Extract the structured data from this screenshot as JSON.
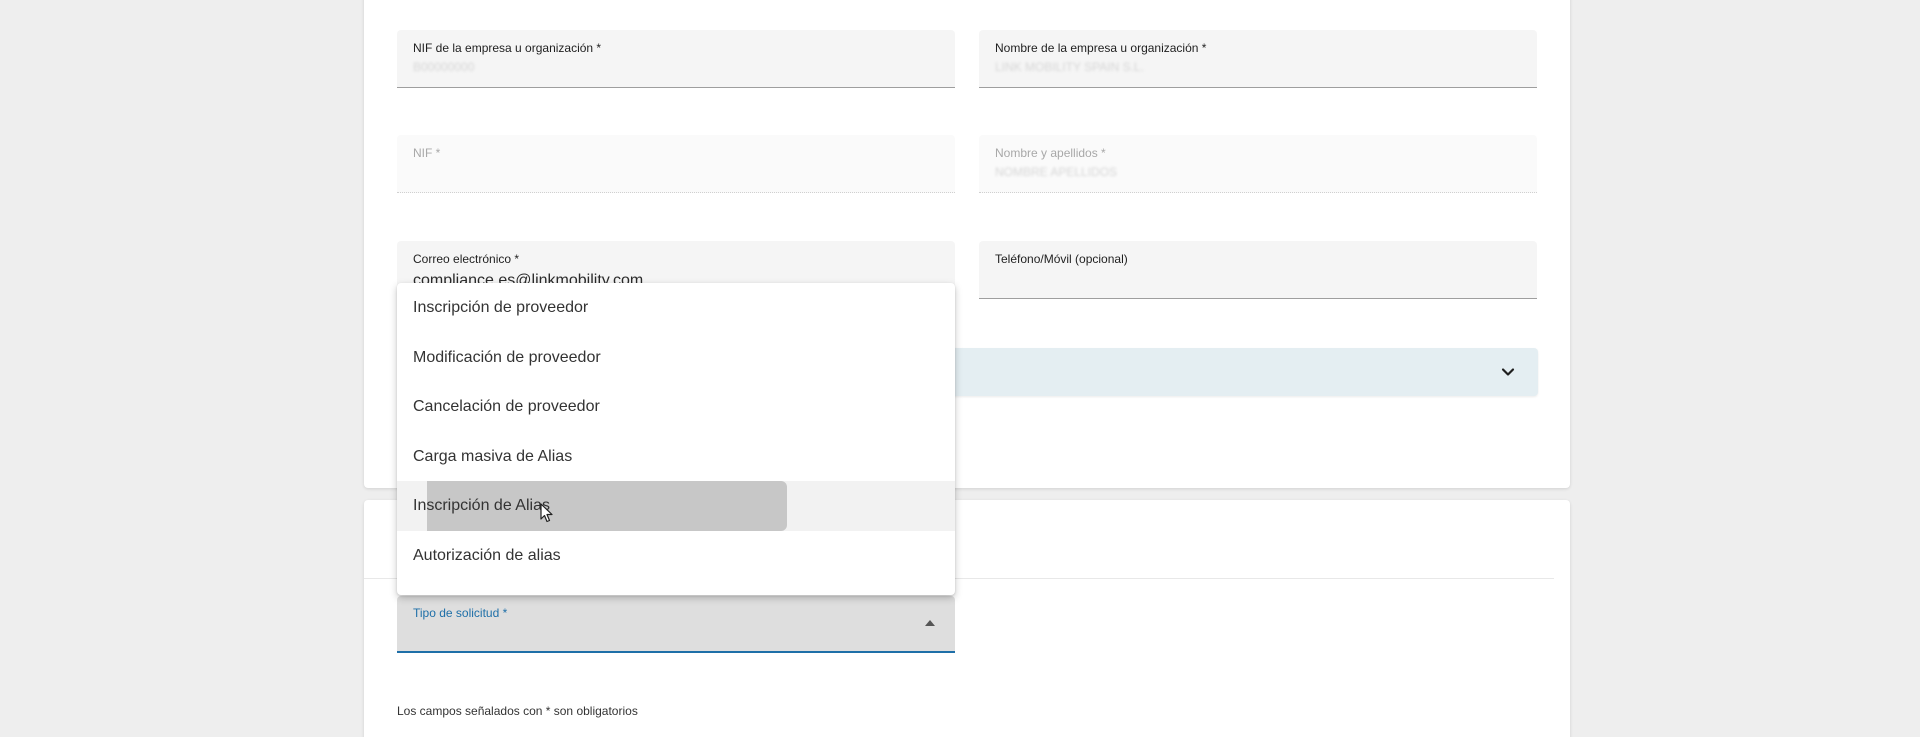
{
  "form": {
    "company_nif": {
      "label": "NIF de la empresa u organización *",
      "value": "B00000000"
    },
    "company_name": {
      "label": "Nombre de la empresa u organización *",
      "value": "LINK MOBILITY SPAIN S.L."
    },
    "nif": {
      "label": "NIF *",
      "value": ""
    },
    "full_name": {
      "label": "Nombre y apellidos *",
      "value": "NOMBRE APELLIDOS"
    },
    "email": {
      "label": "Correo electrónico *",
      "value": "compliance.es@linkmobility.com"
    },
    "phone": {
      "label": "Teléfono/Móvil (opcional)",
      "value": ""
    }
  },
  "accordion": {
    "icon": "chevron-down-icon"
  },
  "request": {
    "type_label": "Tipo de solicitud *",
    "arrow_icon": "arrow-drop-up-icon",
    "required_note": "Los campos señalados con * son obligatorios"
  },
  "dropdown": {
    "options": [
      "Inscripción de proveedor",
      "Modificación de proveedor",
      "Cancelación de proveedor",
      "Carga masiva de Alias",
      "Inscripción de Alias",
      "Autorización de alias"
    ],
    "hovered_index": 4
  },
  "colors": {
    "accent": "#1e6fa8",
    "accordion_bg": "#e4eef2",
    "page_bg": "#eeeeee"
  }
}
